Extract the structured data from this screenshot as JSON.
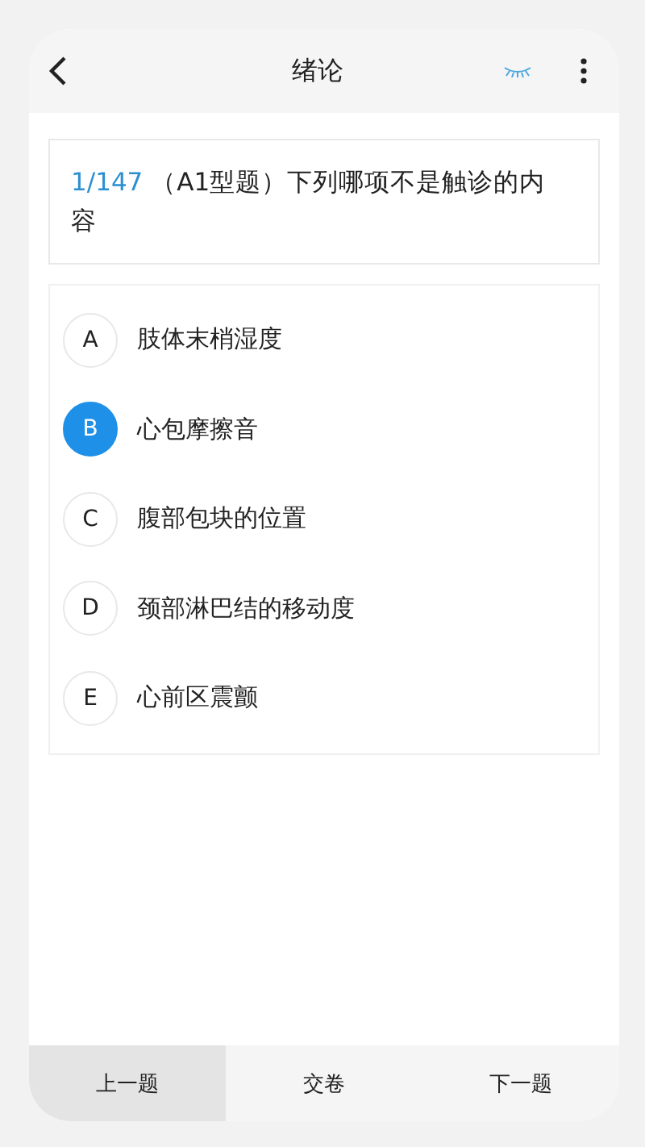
{
  "header": {
    "title": "绪论"
  },
  "question": {
    "index": "1/147",
    "text": "（A1型题）下列哪项不是触诊的内容"
  },
  "options": [
    {
      "letter": "A",
      "text": "肢体末梢湿度",
      "selected": false
    },
    {
      "letter": "B",
      "text": "心包摩擦音",
      "selected": true
    },
    {
      "letter": "C",
      "text": "腹部包块的位置",
      "selected": false
    },
    {
      "letter": "D",
      "text": "颈部淋巴结的移动度",
      "selected": false
    },
    {
      "letter": "E",
      "text": "心前区震颤",
      "selected": false
    }
  ],
  "bottom_bar": [
    {
      "label": "上一题",
      "disabled": true
    },
    {
      "label": "交卷",
      "disabled": false
    },
    {
      "label": "下一题",
      "disabled": false
    }
  ]
}
